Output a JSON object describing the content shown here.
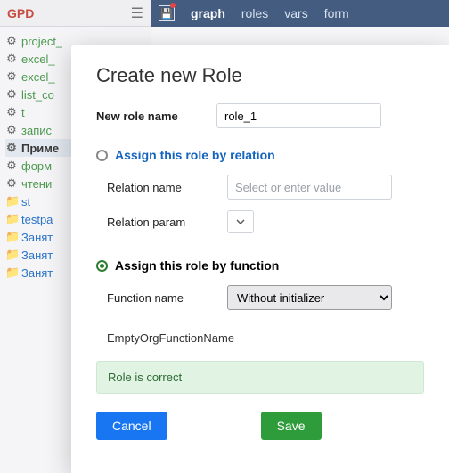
{
  "brand": "GPD",
  "topnav": {
    "items": [
      "graph",
      "roles",
      "vars",
      "form"
    ]
  },
  "tree": {
    "items": [
      {
        "label": "project_",
        "kind": "proc",
        "selected": false
      },
      {
        "label": "excel_",
        "kind": "proc",
        "selected": false
      },
      {
        "label": "excel_",
        "kind": "proc",
        "selected": false
      },
      {
        "label": "list_co",
        "kind": "proc",
        "selected": false
      },
      {
        "label": "t",
        "kind": "proc",
        "selected": false
      },
      {
        "label": "запис",
        "kind": "proc",
        "selected": false
      },
      {
        "label": "Приме",
        "kind": "proc",
        "selected": true
      },
      {
        "label": "форм",
        "kind": "proc",
        "selected": false
      },
      {
        "label": "чтени",
        "kind": "proc",
        "selected": false
      },
      {
        "label": "st",
        "kind": "folder",
        "selected": false
      },
      {
        "label": "testpa",
        "kind": "folder",
        "selected": false
      },
      {
        "label": "Занят",
        "kind": "folder",
        "selected": false
      },
      {
        "label": "Занят",
        "kind": "folder",
        "selected": false
      },
      {
        "label": "Занят",
        "kind": "folder",
        "selected": false
      }
    ]
  },
  "modal": {
    "title": "Create new Role",
    "new_role_label": "New role name",
    "new_role_value": "role_1",
    "assign_relation_label": "Assign this role by relation",
    "relation_name_label": "Relation name",
    "relation_name_placeholder": "Select or enter value",
    "relation_param_label": "Relation param",
    "assign_function_label": "Assign this role by function",
    "function_name_label": "Function name",
    "function_select_value": "Without initializer",
    "empty_org_text": "EmptyOrgFunctionName",
    "status_text": "Role is correct",
    "cancel_label": "Cancel",
    "save_label": "Save"
  }
}
